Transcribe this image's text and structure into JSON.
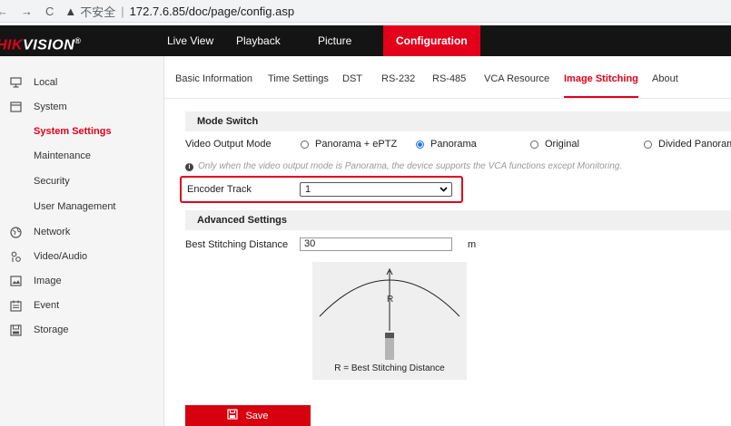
{
  "browser": {
    "back": "←",
    "forward": "→",
    "reload": "C",
    "warning": "▲",
    "insecure_label": "不安全",
    "separator": "|",
    "url": "172.7.6.85/doc/page/config.asp"
  },
  "header": {
    "logo_red": "HIK",
    "logo_white": "VISION",
    "logo_mark": "®",
    "nav": [
      "Live View",
      "Playback",
      "Picture",
      "Configuration"
    ],
    "active_nav": "Configuration"
  },
  "sidebar": {
    "items": [
      {
        "label": "Local",
        "icon": "monitor-icon"
      },
      {
        "label": "System",
        "icon": "system-icon"
      },
      {
        "label": "System Settings",
        "icon": ""
      },
      {
        "label": "Maintenance",
        "icon": ""
      },
      {
        "label": "Security",
        "icon": ""
      },
      {
        "label": "User Management",
        "icon": ""
      },
      {
        "label": "Network",
        "icon": "network-icon"
      },
      {
        "label": "Video/Audio",
        "icon": "video-audio-icon"
      },
      {
        "label": "Image",
        "icon": "image-icon"
      },
      {
        "label": "Event",
        "icon": "event-icon"
      },
      {
        "label": "Storage",
        "icon": "storage-icon"
      }
    ],
    "active": "System Settings"
  },
  "subtabs": [
    "Basic Information",
    "Time Settings",
    "DST",
    "RS-232",
    "RS-485",
    "VCA Resource",
    "Image Stitching",
    "About"
  ],
  "active_subtab": "Image Stitching",
  "mode_switch": {
    "title": "Mode Switch",
    "video_output_label": "Video Output Mode",
    "options": [
      "Panorama + ePTZ",
      "Panorama",
      "Original",
      "Divided Panorama"
    ],
    "selected": "Panorama",
    "note_icon": "i",
    "note": "Only when the video output mode is Panorama, the device supports the VCA functions except Monitoring.",
    "encoder_label": "Encoder Track",
    "encoder_value": "1"
  },
  "advanced": {
    "title": "Advanced Settings",
    "distance_label": "Best Stitching Distance",
    "distance_value": "30",
    "unit": "m",
    "diagram_r": "R",
    "diagram_caption": "R = Best Stitching Distance"
  },
  "save_label": "Save",
  "colors": {
    "accent": "#e3001b",
    "topbar": "#141414",
    "sidebar": "#f5f5f5",
    "radio": "#1a73e8"
  }
}
